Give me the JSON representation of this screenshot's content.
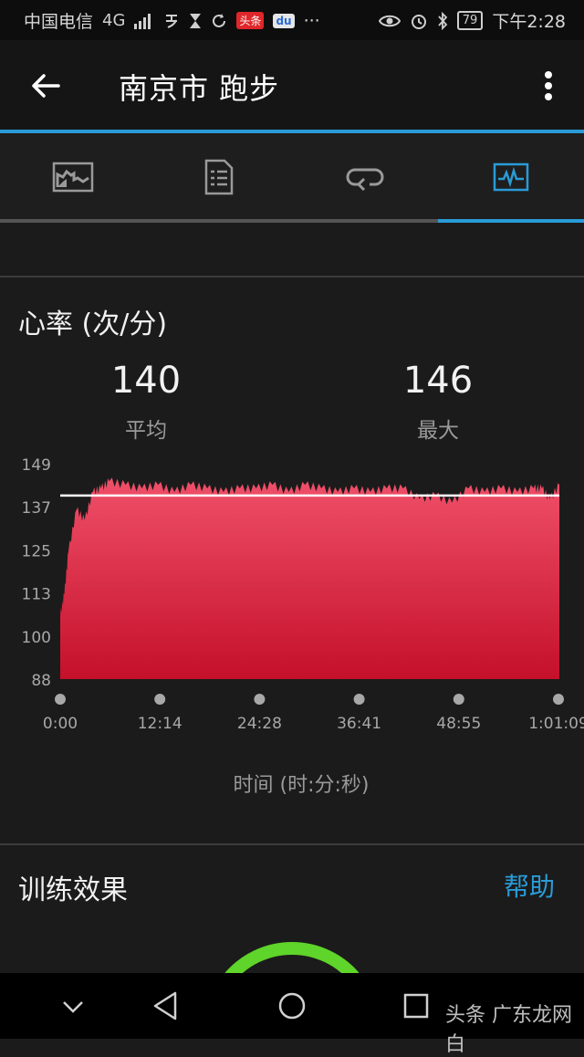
{
  "status_bar": {
    "carrier": "中国电信",
    "network": "4G",
    "time": "下午2:28",
    "battery": "79",
    "badge_toutiao": "头条",
    "badge_baidu": "du",
    "more_dots": "···"
  },
  "header": {
    "title": "南京市 跑步"
  },
  "tabs": [
    {
      "icon": "map-chart-icon",
      "active": false
    },
    {
      "icon": "details-document-icon",
      "active": false
    },
    {
      "icon": "laps-loop-icon",
      "active": false
    },
    {
      "icon": "activity-graph-icon",
      "active": true
    }
  ],
  "heart_rate": {
    "title": "心率 (次/分)",
    "avg_value": "140",
    "avg_label": "平均",
    "max_value": "146",
    "max_label": "最大",
    "x_axis_label": "时间 (时:分:秒)"
  },
  "chart_data": {
    "type": "area",
    "title": "心率 (次/分)",
    "xlabel": "时间 (时:分:秒)",
    "ylabel": "",
    "y_ticks": [
      "149",
      "137",
      "125",
      "113",
      "100",
      "88"
    ],
    "ylim": [
      88,
      149
    ],
    "x_ticks": [
      "0:00",
      "12:14",
      "24:28",
      "36:41",
      "48:55",
      "1:01:09"
    ],
    "xlim_minutes": [
      0,
      61.15
    ],
    "average_line": 140,
    "x_minutes": [
      0,
      0.5,
      1,
      2,
      3,
      4,
      5,
      6,
      8,
      10,
      12,
      14,
      16,
      18,
      20,
      22,
      24,
      26,
      28,
      30,
      32,
      34,
      36,
      38,
      40,
      42,
      44,
      46,
      48,
      50,
      52,
      54,
      56,
      58,
      59,
      60,
      61.15
    ],
    "values": [
      106,
      112,
      124,
      136,
      133,
      141,
      142,
      144,
      143,
      142,
      143,
      141,
      143,
      142,
      141,
      142,
      142,
      143,
      141,
      143,
      142,
      141,
      142,
      141,
      142,
      142,
      139,
      140,
      138,
      142,
      141,
      142,
      141,
      142,
      142,
      139,
      143
    ],
    "fill_color_top": "#f0506a",
    "fill_color_bottom": "#c5102a",
    "avg_line_color": "#ffffff",
    "grid": false
  },
  "training_effect": {
    "title": "训练效果",
    "help": "帮助"
  },
  "watermark": "头条 广东龙网 白"
}
